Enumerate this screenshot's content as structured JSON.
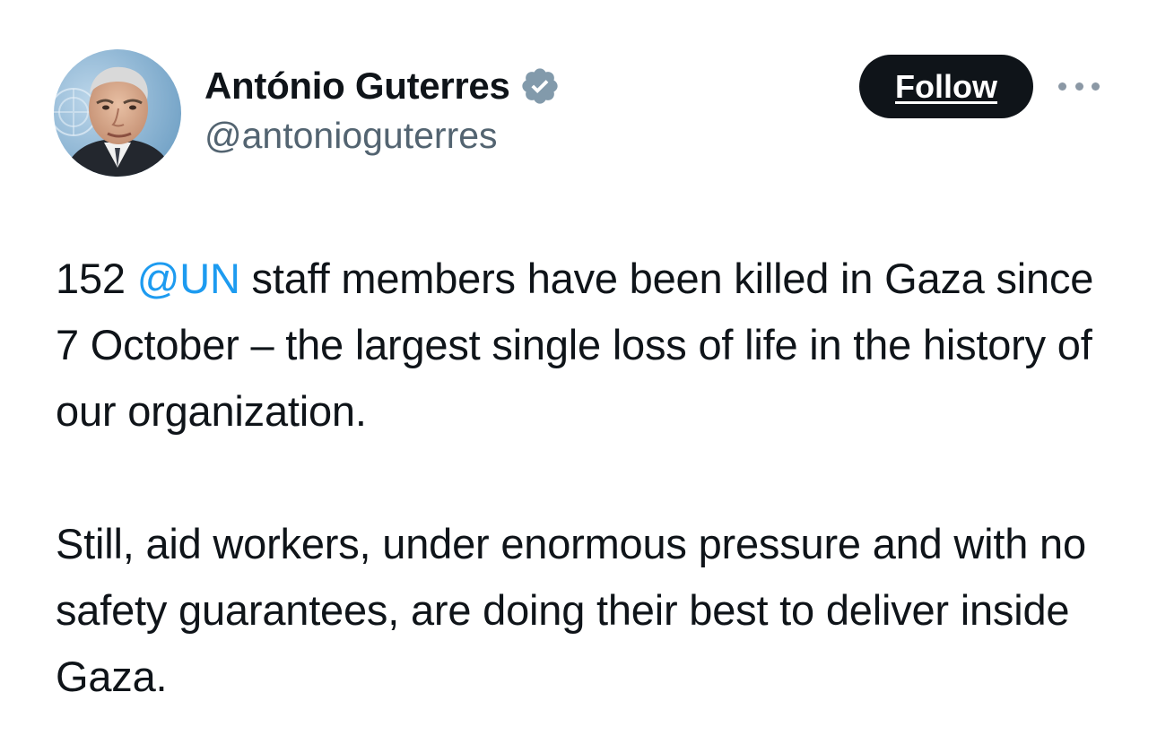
{
  "author": {
    "display_name": "António Guterres",
    "handle": "@antonioguterres",
    "verified": true,
    "verified_icon": "verified-badge-icon",
    "verified_color": "#829aab"
  },
  "actions": {
    "follow_label": "Follow",
    "more_icon": "more-options-icon"
  },
  "tweet": {
    "paragraph1": {
      "before_mention": "152 ",
      "mention": "@UN",
      "after_mention": " staff members have been killed in Gaza since 7 October – the largest single loss of life in the history of our organization."
    },
    "paragraph2": "Still, aid workers, under enormous pressure and with no safety guarantees, are doing their best to deliver inside Gaza."
  },
  "colors": {
    "text": "#0f1419",
    "secondary_text": "#536471",
    "mention": "#1d9bf0",
    "follow_bg": "#0f1419",
    "follow_text": "#ffffff"
  }
}
